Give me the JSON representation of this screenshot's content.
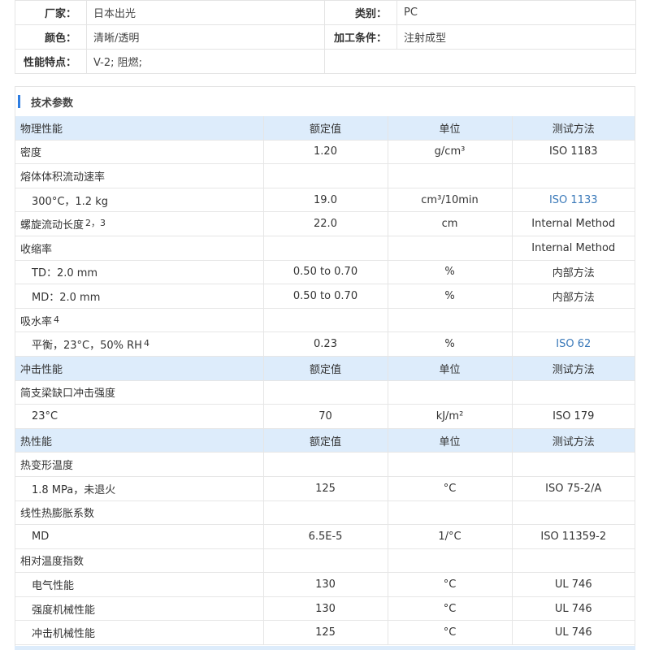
{
  "info": {
    "rows": [
      [
        {
          "k": "厂家：",
          "v": "日本出光"
        },
        {
          "k": "类别：",
          "v": "PC"
        }
      ],
      [
        {
          "k": "颜色：",
          "v": "清晰/透明"
        },
        {
          "k": "加工条件：",
          "v": "注射成型"
        }
      ],
      [
        {
          "k": "性能特点：",
          "v": "V-2; 阻燃;"
        },
        {
          "k": "",
          "v": ""
        }
      ]
    ]
  },
  "section": {
    "title": "技术参数"
  },
  "colors": {
    "accent": "#2e7de1",
    "header_bg": "#ddecfb",
    "link": "#3a79b9"
  },
  "params": [
    {
      "type": "header",
      "cells": [
        "物理性能",
        "额定值",
        "单位",
        "测试方法"
      ]
    },
    {
      "type": "row",
      "name": "密度",
      "value": "1.20",
      "unit": "g/cm³",
      "method": "ISO 1183"
    },
    {
      "type": "row",
      "name": "熔体体积流动速率",
      "value": "",
      "unit": "",
      "method": ""
    },
    {
      "type": "row",
      "sub": true,
      "name": "300°C，1.2 kg",
      "value": "19.0",
      "unit": "cm³/10min",
      "method": "ISO 1133",
      "link": true
    },
    {
      "type": "row",
      "name": "螺旋流动长度",
      "sup": "2，3",
      "value": "22.0",
      "unit": "cm",
      "method": "Internal Method"
    },
    {
      "type": "row",
      "name": "收缩率",
      "value": "",
      "unit": "",
      "method": "Internal Method"
    },
    {
      "type": "row",
      "sub": true,
      "name": "TD：2.0 mm",
      "value": "0.50 to 0.70",
      "unit": "%",
      "method": "内部方法"
    },
    {
      "type": "row",
      "sub": true,
      "name": "MD：2.0 mm",
      "value": "0.50 to 0.70",
      "unit": "%",
      "method": "内部方法"
    },
    {
      "type": "row",
      "name": "吸水率",
      "sup": "4",
      "value": "",
      "unit": "",
      "method": ""
    },
    {
      "type": "row",
      "sub": true,
      "name": "平衡，23°C，50% RH",
      "sup": "4",
      "value": "0.23",
      "unit": "%",
      "method": "ISO 62",
      "link": true
    },
    {
      "type": "header",
      "cells": [
        "冲击性能",
        "额定值",
        "单位",
        "测试方法"
      ]
    },
    {
      "type": "row",
      "name": "简支梁缺口冲击强度",
      "value": "",
      "unit": "",
      "method": ""
    },
    {
      "type": "row",
      "sub": true,
      "name": "23°C",
      "value": "70",
      "unit": "kJ/m²",
      "method": "ISO 179"
    },
    {
      "type": "header",
      "cells": [
        "热性能",
        "额定值",
        "单位",
        "测试方法"
      ]
    },
    {
      "type": "row",
      "name": "热变形温度",
      "value": "",
      "unit": "",
      "method": ""
    },
    {
      "type": "row",
      "sub": true,
      "name": "1.8 MPa，未退火",
      "value": "125",
      "unit": "°C",
      "method": "ISO 75-2/A"
    },
    {
      "type": "row",
      "name": "线性热膨胀系数",
      "value": "",
      "unit": "",
      "method": ""
    },
    {
      "type": "row",
      "sub": true,
      "name": "MD",
      "value": "6.5E-5",
      "unit": "1/°C",
      "method": "ISO 11359-2"
    },
    {
      "type": "row",
      "name": "相对温度指数",
      "value": "",
      "unit": "",
      "method": ""
    },
    {
      "type": "row",
      "sub": true,
      "name": "电气性能",
      "value": "130",
      "unit": "°C",
      "method": "UL 746"
    },
    {
      "type": "row",
      "sub": true,
      "name": "强度机械性能",
      "value": "130",
      "unit": "°C",
      "method": "UL 746"
    },
    {
      "type": "row",
      "sub": true,
      "name": "冲击机械性能",
      "value": "125",
      "unit": "°C",
      "method": "UL 746"
    }
  ]
}
